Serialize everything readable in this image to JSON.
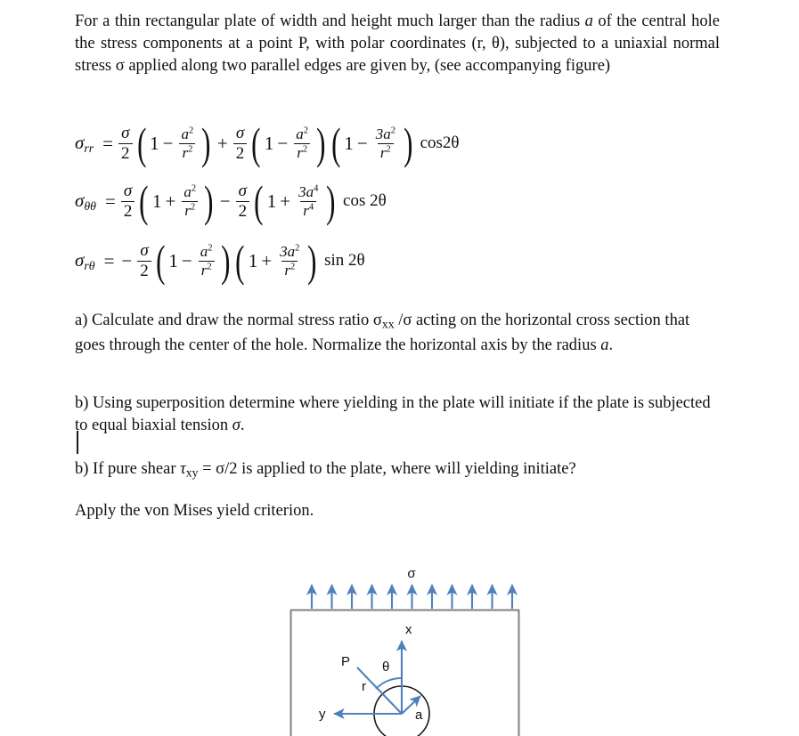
{
  "document": {
    "intro_paragraph": "For a thin rectangular plate of width and height much larger than the radius a of the central hole the stress components at a point P, with polar coordinates (r, θ), subjected to a uniaxial normal stress σ applied along two parallel edges are given by, (see accompanying figure)",
    "intro_segments": {
      "s1": "For a thin rectangular plate of width and height much larger than the radius ",
      "s2": "a",
      "s3": " of the central hole the stress components at a point P, with polar coordinates (r, θ), subjected to a uniaxial normal stress σ applied along two parallel edges are given by, (see accompanying figure)"
    },
    "equations": [
      {
        "id": "sigma-rr",
        "plain": "σ_rr = σ/2 (1 − a²/r²) + σ/2 (1 − a²/r²)(1 − 3a²/r²) cos2θ",
        "lhs_base": "σ",
        "lhs_sub": "rr",
        "equals": "=",
        "sigma": "σ",
        "two": "2",
        "plus": "+",
        "one": "1",
        "minus": "−",
        "a_num": "a",
        "r_den": "r",
        "three_a_num": "3a",
        "trig": "cos2θ"
      },
      {
        "id": "sigma-theta-theta",
        "plain": "σ_θθ = σ/2 (1 + a²/r²) − σ/2 (1 + 3a⁴/r⁴) cos2θ",
        "lhs_base": "σ",
        "lhs_sub": "θθ",
        "equals": "=",
        "sigma": "σ",
        "two": "2",
        "plus": "+",
        "minus": "−",
        "one": "1",
        "a_num": "a",
        "r_den": "r",
        "three_a_num": "3a",
        "trig": "cos 2θ"
      },
      {
        "id": "sigma-r-theta",
        "plain": "σ_rθ = − σ/2 (1 − a²/r²)(1 + 3a²/r²) sin2θ",
        "lhs_base": "σ",
        "lhs_sub": "rθ",
        "equals": "=",
        "leading_minus": "−",
        "sigma": "σ",
        "two": "2",
        "plus": "+",
        "minus": "−",
        "one": "1",
        "a_num": "a",
        "r_den": "r",
        "three_a_num": "3a",
        "trig": "sin 2θ"
      }
    ],
    "question_a": {
      "s1": "a) Calculate and draw the normal stress ratio σ",
      "s_sub": "xx",
      "s2": " /σ acting on the horizontal cross section that goes through the center of the hole. Normalize the horizontal axis by the radius ",
      "s3": "a",
      "s4": "."
    },
    "question_b1": {
      "s1": "b) Using superposition determine where yielding in the plate will initiate if the plate is subjected to equal biaxial tension ",
      "s2": "σ",
      "s3": "."
    },
    "question_b2": {
      "s1": "b) If pure shear ",
      "s2": "τ",
      "s_sub": "xy",
      "s3": " = σ/2 is applied to the plate, where will yielding initiate?"
    },
    "closing_line": "Apply the von Mises yield criterion."
  },
  "figure": {
    "name": "plate-with-central-hole-diagram",
    "load_label": "σ",
    "axis_x_label": "x",
    "axis_y_label": "y",
    "point_label": "P",
    "angle_label": "θ",
    "radial_label": "r",
    "hole_radius_label": "a",
    "arrow_count": 11,
    "colors": {
      "arrow_blue": "#4F81BD",
      "plate_outline": "#808080",
      "hole_outline": "#1a1a1a",
      "label_black": "#111111"
    }
  }
}
